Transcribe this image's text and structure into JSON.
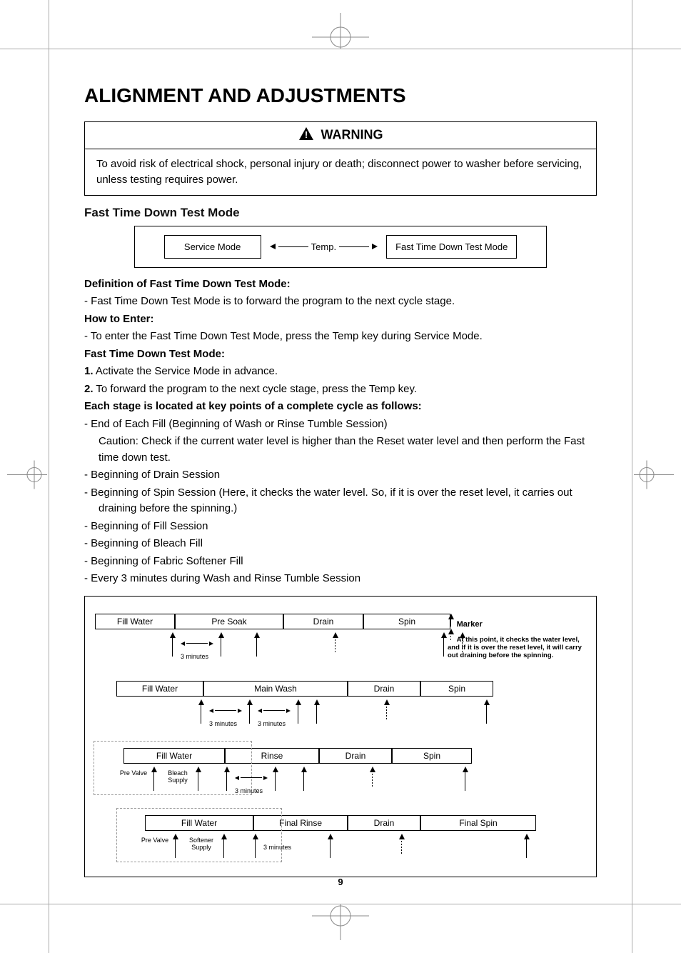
{
  "page_number": "9",
  "title": "ALIGNMENT AND ADJUSTMENTS",
  "warning": {
    "label": "WARNING",
    "text": "To avoid risk of electrical shock, personal injury or death; disconnect power to washer before servicing, unless testing requires power."
  },
  "section_title": "Fast Time Down Test Mode",
  "mode_nav": {
    "left": "Service Mode",
    "mid": "Temp.",
    "right": "Fast Time Down Test Mode"
  },
  "defs": {
    "h1": "Definition of Fast Time Down Test Mode:",
    "l1": "-   Fast Time Down Test Mode is to forward the program to the next cycle stage.",
    "h2": "How to Enter:",
    "l2": "-   To enter the Fast Time Down Test Mode, press the Temp key during Service Mode.",
    "h3": "Fast Time Down Test Mode:",
    "s1n": "1.",
    "s1": " Activate the Service Mode in advance.",
    "s2n": "2.",
    "s2": " To forward the program to the next cycle stage, press the Temp key.",
    "h4": "Each stage is located at key points of a complete cycle as follows:",
    "b1": "-   End of Each Fill (Beginning of Wash or Rinse Tumble Session)",
    "b1c": "Caution: Check if the current water level is higher than the Reset water level and then perform the Fast time down test.",
    "b2": "-   Beginning of Drain Session",
    "b3": "-   Beginning of Spin Session (Here, it checks the water level. So, if it is over the reset level, it carries out draining before the spinning.)",
    "b4": "-   Beginning of Fill Session",
    "b5": "-   Beginning of Bleach Fill",
    "b6": "-   Beginning of Fabric Softener Fill",
    "b7": "-   Every 3 minutes during Wash and Rinse Tumble Session"
  },
  "marker": {
    "title": "Marker",
    "text": "At this point, it checks the water level, and if it is over the reset level, it will carry out draining before the spinning."
  },
  "diag": {
    "three_min": "3 minutes",
    "pre_valve": "Pre Valve",
    "bleach": "Bleach Supply",
    "softener": "Softener Supply",
    "rows": [
      {
        "stages": [
          "Fill Water",
          "Pre Soak",
          "Drain",
          "Spin"
        ]
      },
      {
        "stages": [
          "Fill Water",
          "Main Wash",
          "Drain",
          "Spin"
        ]
      },
      {
        "stages": [
          "Fill Water",
          "Rinse",
          "Drain",
          "Spin"
        ]
      },
      {
        "stages": [
          "Fill Water",
          "Final Rinse",
          "Drain",
          "Final Spin"
        ]
      }
    ]
  }
}
